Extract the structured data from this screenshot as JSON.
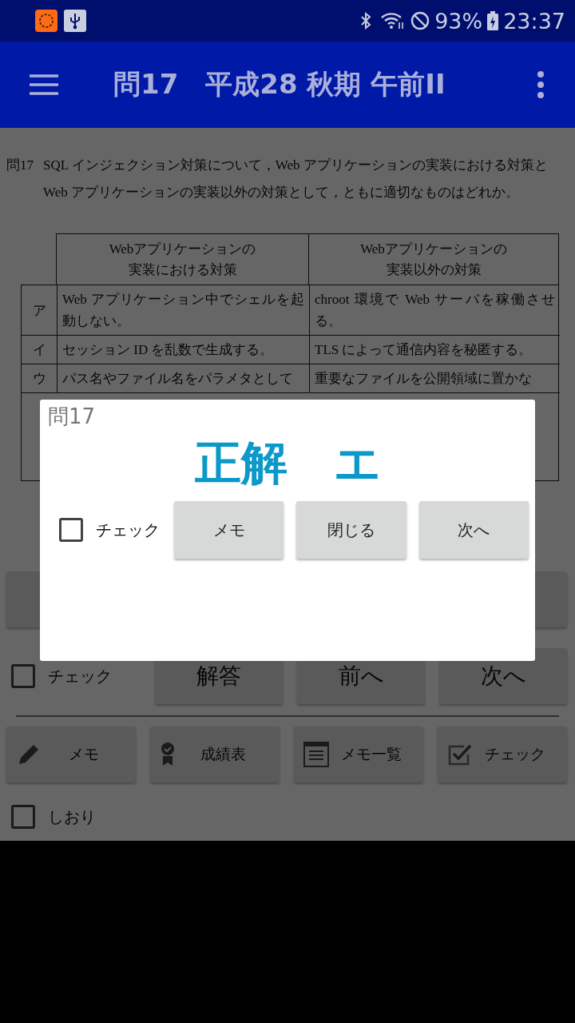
{
  "status_bar": {
    "battery": "93%",
    "time": "23:37"
  },
  "app_bar": {
    "title": "問17　平成28 秋期 午前II"
  },
  "question": {
    "number": "問17",
    "text": "SQL インジェクション対策について，Web アプリケーションの実装における対策と Web アプリケーションの実装以外の対策として，ともに適切なものはどれか。"
  },
  "table": {
    "columns": [
      {
        "lines": [
          "Webアプリケーションの",
          "実装における対策"
        ]
      },
      {
        "lines": [
          "Webアプリケーションの",
          "実装以外の対策"
        ]
      }
    ],
    "rows": [
      {
        "label": "ア",
        "cells": [
          "Web アプリケーション中でシェルを起動しない。",
          "chroot 環境で Web サーバを稼働させる。"
        ]
      },
      {
        "label": "イ",
        "cells": [
          "セッション ID を乱数で生成する。",
          "TLS によって通信内容を秘匿する。"
        ]
      },
      {
        "label": "ウ",
        "cells": [
          "パス名やファイル名をパラメタとして",
          "重要なファイルを公開領域に置かな"
        ]
      }
    ]
  },
  "nav": {
    "check": {
      "label": "チェック",
      "checked": false
    },
    "buttons": [
      "解答",
      "前へ",
      "次へ"
    ]
  },
  "tools": [
    {
      "kind": "pencil",
      "label": "メモ"
    },
    {
      "kind": "badge",
      "label": "成績表"
    },
    {
      "kind": "list",
      "label": "メモ一覧"
    },
    {
      "kind": "check",
      "label": "チェック"
    }
  ],
  "bookmark": {
    "label": "しおり",
    "checked": false
  },
  "dialog": {
    "title": "問17",
    "answer": "正解　エ",
    "check": {
      "label": "チェック",
      "checked": false
    },
    "buttons": [
      "メモ",
      "閉じる",
      "次へ"
    ]
  }
}
